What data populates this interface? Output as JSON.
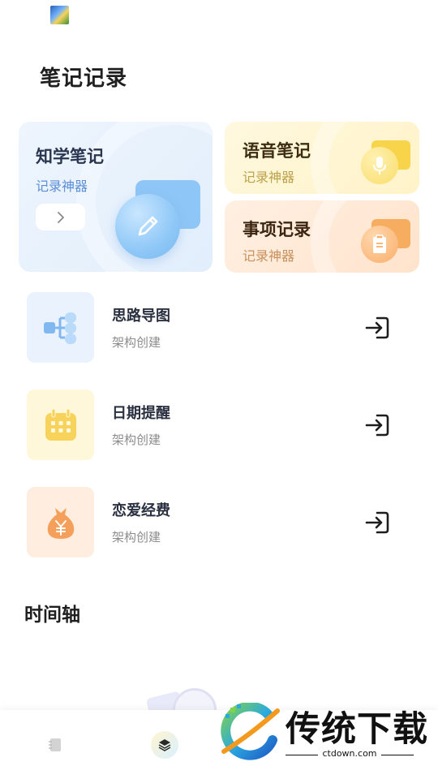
{
  "header": {
    "title": "笔记记录"
  },
  "cards": {
    "knowledge": {
      "title": "知学笔记",
      "subtitle": "记录神器"
    },
    "voice": {
      "title": "语音笔记",
      "subtitle": "记录神器"
    },
    "todo": {
      "title": "事项记录",
      "subtitle": "记录神器"
    }
  },
  "list": [
    {
      "title": "思路导图",
      "subtitle": "架构创建",
      "icon": "mind-map-icon",
      "bg": "#eaf3fd"
    },
    {
      "title": "日期提醒",
      "subtitle": "架构创建",
      "icon": "calendar-icon",
      "bg": "#fff7d9"
    },
    {
      "title": "恋爱经费",
      "subtitle": "架构创建",
      "icon": "money-bag-icon",
      "bg": "#ffeee0"
    }
  ],
  "timeline": {
    "title": "时间轴"
  },
  "watermark": {
    "title": "传统下载",
    "url": "ctdown.com"
  },
  "colors": {
    "blue_card": "#e4effc",
    "yellow_card": "#fff5d1",
    "orange_card": "#ffe6d0",
    "accent_blue": "#5b8ed6"
  }
}
